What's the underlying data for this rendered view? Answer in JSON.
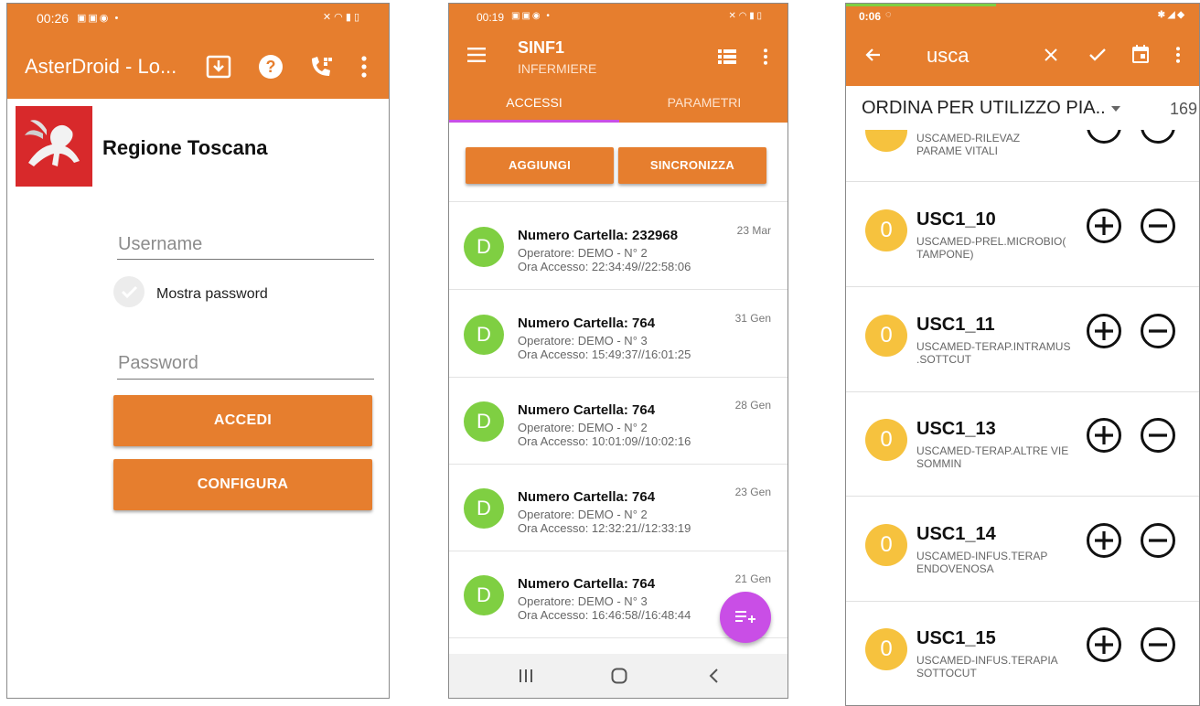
{
  "colors": {
    "accent": "#e67e2e",
    "avatar": "#7fcf42",
    "badge": "#f6c23e",
    "fab": "#c94ee6"
  },
  "login_screen": {
    "status_time": "00:26",
    "app_title": "AsterDroid - Lo...",
    "icons": [
      "download-icon",
      "help-icon",
      "phone-settings-icon",
      "more-vert-icon"
    ],
    "region_name": "Regione Toscana",
    "username_placeholder": "Username",
    "show_password_label": "Mostra password",
    "password_placeholder": "Password",
    "login_button": "ACCEDI",
    "configure_button": "CONFIGURA"
  },
  "access_screen": {
    "status_time": "00:19",
    "title": "SINF1",
    "subtitle": "INFERMIERE",
    "tabs": [
      {
        "label": "ACCESSI"
      },
      {
        "label": "PARAMETRI"
      }
    ],
    "add_button": "AGGIUNGI",
    "sync_button": "SINCRONIZZA",
    "items": [
      {
        "initial": "D",
        "title": "Numero Cartella: 232968",
        "operator": "Operatore: DEMO - N° 2",
        "time": "Ora Accesso: 22:34:49//22:58:06",
        "date": "23 Mar"
      },
      {
        "initial": "D",
        "title": "Numero Cartella: 764",
        "operator": "Operatore: DEMO - N° 3",
        "time": "Ora Accesso: 15:49:37//16:01:25",
        "date": "31 Gen"
      },
      {
        "initial": "D",
        "title": "Numero Cartella: 764",
        "operator": "Operatore: DEMO - N° 2",
        "time": "Ora Accesso: 10:01:09//10:02:16",
        "date": "28 Gen"
      },
      {
        "initial": "D",
        "title": "Numero Cartella: 764",
        "operator": "Operatore: DEMO - N° 2",
        "time": "Ora Accesso: 12:32:21//12:33:19",
        "date": "23 Gen"
      },
      {
        "initial": "D",
        "title": "Numero Cartella: 764",
        "operator": "Operatore: DEMO - N° 3",
        "time": "Ora Accesso: 16:46:58//16:48:44",
        "date": "21 Gen"
      }
    ]
  },
  "services_screen": {
    "status_time": "0:06",
    "search_text": "usca",
    "sort_label": "ORDINA PER UTILIZZO PIA..",
    "count": "169",
    "partial_row": {
      "desc_line1": "USCAMED-RILEVAZ",
      "desc_line2": "PARAME VITALI"
    },
    "rows": [
      {
        "count": "0",
        "code": "USC1_10",
        "desc_line1": "USCAMED-PREL.MICROBIO(",
        "desc_line2": "TAMPONE)"
      },
      {
        "count": "0",
        "code": "USC1_11",
        "desc_line1": "USCAMED-TERAP.INTRAMUS",
        "desc_line2": ".SOTTCUT"
      },
      {
        "count": "0",
        "code": "USC1_13",
        "desc_line1": "USCAMED-TERAP.ALTRE VIE",
        "desc_line2": "SOMMIN"
      },
      {
        "count": "0",
        "code": "USC1_14",
        "desc_line1": "USCAMED-INFUS.TERAP",
        "desc_line2": "ENDOVENOSA"
      },
      {
        "count": "0",
        "code": "USC1_15",
        "desc_line1": "USCAMED-INFUS.TERAPIA",
        "desc_line2": "SOTTOCUT"
      }
    ]
  }
}
